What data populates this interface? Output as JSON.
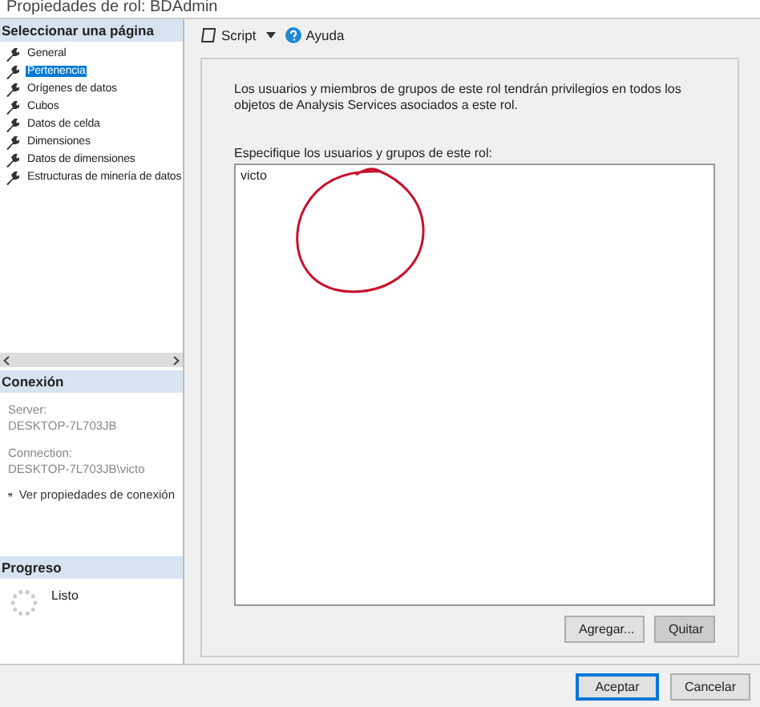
{
  "window": {
    "title": "Propiedades de rol: BDAdmin"
  },
  "sidebar": {
    "header": "Seleccionar una página",
    "items": [
      {
        "label": "General",
        "selected": false
      },
      {
        "label": "Pertenencia",
        "selected": true
      },
      {
        "label": "Orígenes de datos",
        "selected": false
      },
      {
        "label": "Cubos",
        "selected": false
      },
      {
        "label": "Datos de celda",
        "selected": false
      },
      {
        "label": "Dimensiones",
        "selected": false
      },
      {
        "label": "Datos de dimensiones",
        "selected": false
      },
      {
        "label": "Estructuras de minería de datos",
        "selected": false
      }
    ]
  },
  "connection": {
    "header": "Conexión",
    "server_label": "Server:",
    "server": "DESKTOP-7L703JB",
    "connection_label": "Connection:",
    "connection": "DESKTOP-7L703JB\\victo",
    "link": "Ver propiedades de conexión"
  },
  "progress": {
    "header": "Progreso",
    "status": "Listo"
  },
  "toolbar": {
    "script": "Script",
    "help": "Ayuda"
  },
  "description": "Los usuarios y miembros de grupos de este rol tendrán privilegios en todos los objetos de Analysis Services asociados a este rol.",
  "members_label": "Especifique los usuarios y grupos de este rol:",
  "members": [
    "victo"
  ],
  "buttons": {
    "add": "Agregar...",
    "remove": "Quitar",
    "ok": "Aceptar",
    "cancel": "Cancelar"
  }
}
